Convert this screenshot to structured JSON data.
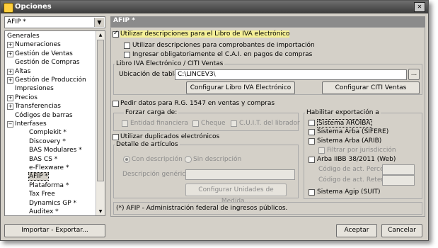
{
  "window": {
    "title": "Opciones",
    "close_label": "✕"
  },
  "scope_combo": {
    "value": "AFIP *"
  },
  "tree": {
    "items": [
      {
        "label": "Generales",
        "level": 0,
        "expander": ""
      },
      {
        "label": "Numeraciones",
        "level": 1,
        "expander": "+"
      },
      {
        "label": "Gestión de Ventas",
        "level": 1,
        "expander": "+"
      },
      {
        "label": "Gestión de Compras",
        "level": 1,
        "expander": ""
      },
      {
        "label": "Altas",
        "level": 1,
        "expander": "+"
      },
      {
        "label": "Gestión de Producción",
        "level": 1,
        "expander": "+"
      },
      {
        "label": "Impresiones",
        "level": 1,
        "expander": ""
      },
      {
        "label": "Precios",
        "level": 1,
        "expander": "+"
      },
      {
        "label": "Transferencias",
        "level": 1,
        "expander": "+"
      },
      {
        "label": "Códigos de barras",
        "level": 1,
        "expander": ""
      },
      {
        "label": "Interfases",
        "level": 1,
        "expander": "-"
      },
      {
        "label": "Complekit *",
        "level": 2,
        "expander": ""
      },
      {
        "label": "Discovery *",
        "level": 2,
        "expander": ""
      },
      {
        "label": "BAS Modulares *",
        "level": 2,
        "expander": ""
      },
      {
        "label": "BAS CS *",
        "level": 2,
        "expander": ""
      },
      {
        "label": "e-Flexware *",
        "level": 2,
        "expander": ""
      },
      {
        "label": "AFIP *",
        "level": 2,
        "expander": "",
        "selected": true
      },
      {
        "label": "Plataforma *",
        "level": 2,
        "expander": ""
      },
      {
        "label": "Tax Free",
        "level": 2,
        "expander": ""
      },
      {
        "label": "Dynamics GP *",
        "level": 2,
        "expander": ""
      },
      {
        "label": "Auditex *",
        "level": 2,
        "expander": ""
      }
    ]
  },
  "panel": {
    "title": "AFIP *",
    "use_iva_book": {
      "label": "Utilizar descripciones para el Libro de IVA electrónico",
      "checked": true
    },
    "use_import_desc": {
      "label": "Utilizar descripciones para comprobantes de importación"
    },
    "enter_cai": {
      "label": "Ingresar obligatoriamente el C.A.I. en pagos de compras"
    },
    "libro_iva_group": {
      "title": "Libro IVA Electrónico / CITI Ventas",
      "location_label": "Ubicación de tablas:",
      "location_value": "C:\\LINCEV3\\",
      "browse_label": "...",
      "config_iva_button": "Configurar Libro IVA Electrónico",
      "config_citi_button": "Configurar CITI Ventas"
    },
    "request_rg1547": {
      "label": "Pedir datos para R.G. 1547 en ventas y compras"
    },
    "forzar_carga": {
      "title": "Forzar carga de:",
      "entidad": "Entidad financiera",
      "cheque": "Cheque",
      "cuit": "C.U.I.T. del librador"
    },
    "use_duplicates": {
      "label": "Utilizar duplicados electrónicos"
    },
    "detalle_articulos": {
      "title": "Detalle de artículos",
      "con_desc": "Con descripción",
      "sin_desc": "Sin descripción",
      "generic_desc_label": "Descripción genérica:",
      "config_units_button": "Configurar Unidades de Medida..."
    },
    "habilitar_export": {
      "title": "Habilitar exportación a",
      "aroiba": "Sistema AROIBA",
      "arba_sifere": "Sistema Arba (SIFERE)",
      "arba_arib": "Sistema Arba (ARIB)",
      "filtrar_jurisdiccion": "Filtrar por jurisdicción",
      "arba_iibb": "Arba IIBB 38/2011 (Web)",
      "cod_percep": "Código de act. Percep.",
      "cod_reten": "Código de act. Reten.",
      "agip": "Sistema Agip (SUIT)"
    },
    "footnote": "(*) AFIP - Administración federal de ingresos públicos."
  },
  "footer": {
    "import_export": "Importar - Exportar...",
    "accept": "Aceptar",
    "cancel": "Cancelar"
  }
}
